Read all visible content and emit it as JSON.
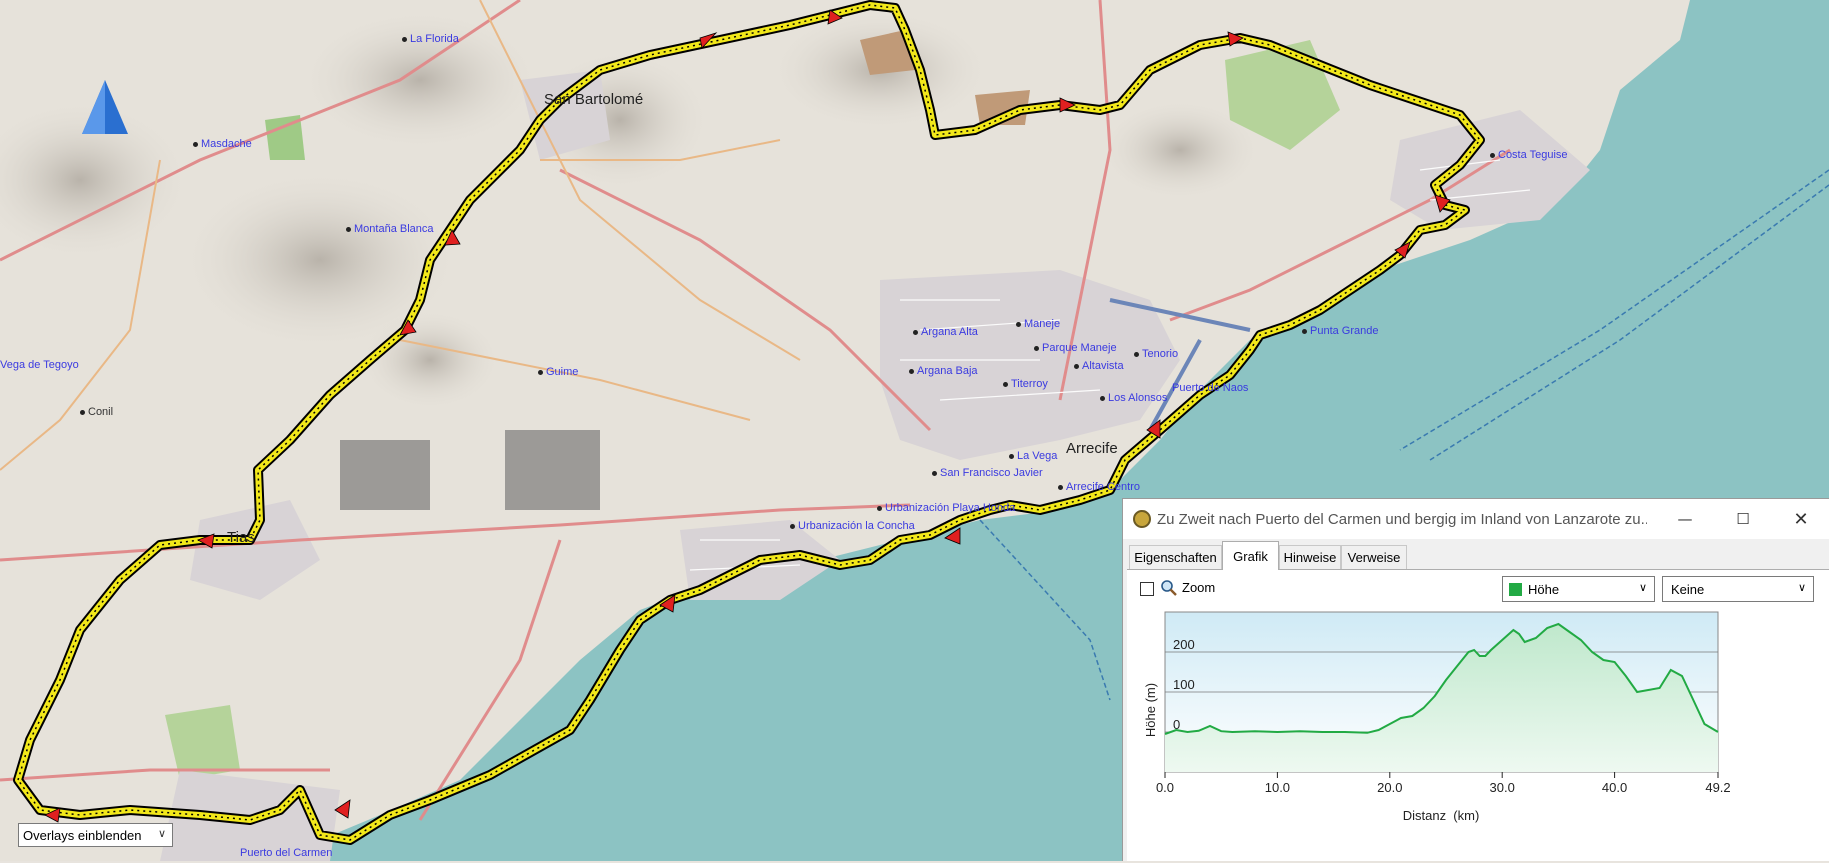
{
  "map": {
    "towns": [
      {
        "name": "San Bartolomé"
      },
      {
        "name": "Arrecife"
      },
      {
        "name": "Tias"
      }
    ],
    "places": [
      {
        "name": "La Florida"
      },
      {
        "name": "Masdache"
      },
      {
        "name": "Montaña Blanca"
      },
      {
        "name": "Vega de Tegoyo"
      },
      {
        "name": "Conil"
      },
      {
        "name": "Guime"
      },
      {
        "name": "Costa Teguise"
      },
      {
        "name": "Punta Grande"
      },
      {
        "name": "Maneje"
      },
      {
        "name": "Argana Alta"
      },
      {
        "name": "Parque Maneje"
      },
      {
        "name": "Tenorio"
      },
      {
        "name": "Argana Baja"
      },
      {
        "name": "Altavista"
      },
      {
        "name": "Titerroy"
      },
      {
        "name": "Puerto de Naos"
      },
      {
        "name": "Los Alonsos"
      },
      {
        "name": "La Vega"
      },
      {
        "name": "San Francisco Javier"
      },
      {
        "name": "Arrecife Centro"
      },
      {
        "name": "Urbanización Playa Honda"
      },
      {
        "name": "Urbanización la Concha"
      },
      {
        "name": "Puerto del Carmen"
      }
    ],
    "overlay_select": "Overlays einblenden"
  },
  "window": {
    "title": "Zu Zweit nach Puerto del Carmen und bergig im Inland von Lanzarote zu...",
    "tabs": [
      "Eigenschaften",
      "Grafik",
      "Hinweise",
      "Verweise"
    ],
    "active_tab": "Grafik",
    "zoom_label": "Zoom",
    "zoom_checked": false,
    "dropdown_left": "Höhe",
    "dropdown_right": "Keine",
    "series_color": "#22aa44"
  },
  "chart_data": {
    "type": "area",
    "ylabel": "Höhe (m)",
    "xlabel": "Distanz  (km)",
    "x_ticks": [
      "0.0",
      "10.0",
      "20.0",
      "30.0",
      "40.0",
      "49.2"
    ],
    "y_ticks": [
      "0",
      "100",
      "200"
    ],
    "xlim": [
      0,
      49.2
    ],
    "ylim": [
      -100,
      300
    ],
    "grid": true,
    "x": [
      0,
      1,
      2,
      3,
      4,
      5,
      6,
      8,
      10,
      12,
      14,
      16,
      18,
      19,
      20,
      21,
      22,
      23,
      24,
      25,
      26,
      27,
      27.5,
      28,
      28.5,
      29,
      30,
      31,
      31.5,
      32,
      33,
      34,
      35,
      36,
      37,
      38,
      39,
      40,
      41,
      42,
      43,
      44,
      45,
      46,
      47,
      48,
      49.2
    ],
    "y": [
      -5,
      5,
      0,
      3,
      15,
      2,
      0,
      2,
      0,
      2,
      0,
      0,
      -2,
      5,
      20,
      35,
      40,
      60,
      90,
      130,
      165,
      200,
      205,
      190,
      190,
      205,
      230,
      255,
      245,
      225,
      235,
      260,
      270,
      250,
      230,
      200,
      180,
      175,
      140,
      100,
      105,
      110,
      155,
      140,
      80,
      20,
      0
    ]
  }
}
